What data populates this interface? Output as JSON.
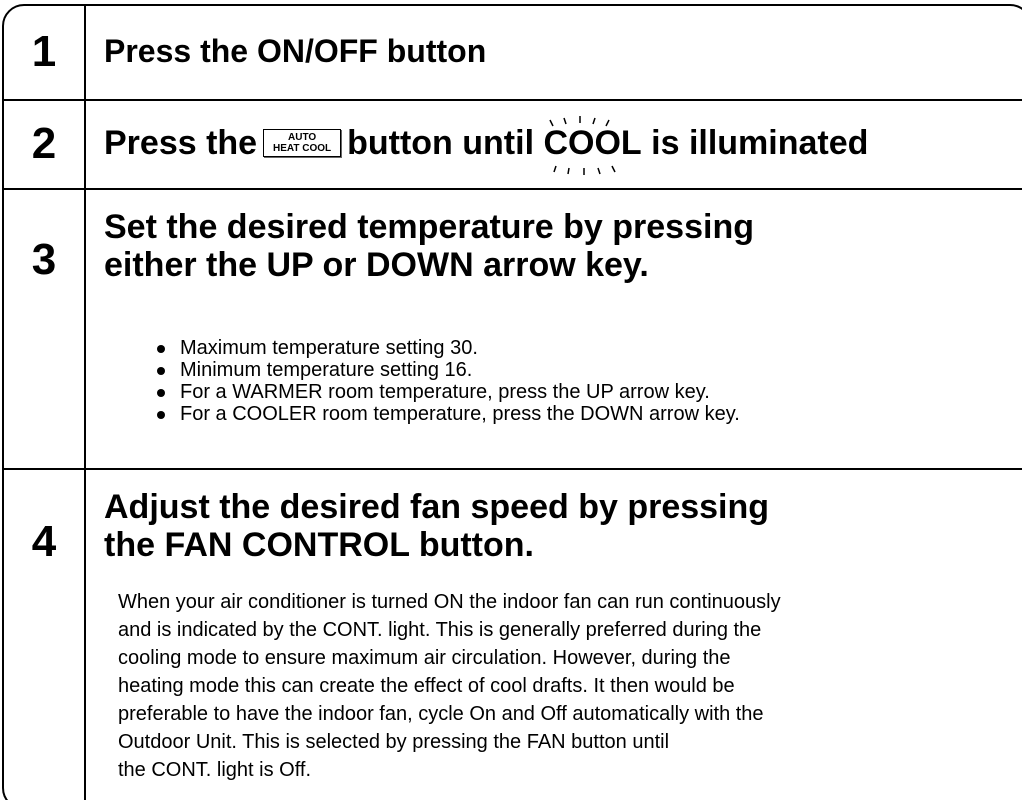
{
  "steps": [
    {
      "number": "1",
      "heading": "Press the ON/OFF button"
    },
    {
      "number": "2",
      "heading_before": "Press the",
      "mode_button_top": "AUTO",
      "mode_button_bottom": "HEAT COOL",
      "heading_middle": "button until",
      "illuminated_word": "COOL",
      "heading_after": "is illuminated"
    },
    {
      "number": "3",
      "heading_lines": [
        "Set the desired temperature by pressing",
        "either the UP or DOWN arrow key."
      ],
      "bullets": [
        "Maximum temperature setting 30.",
        "Minimum temperature setting 16.",
        "For a WARMER room temperature, press the UP arrow key.",
        "For a COOLER room temperature, press the DOWN arrow key."
      ]
    },
    {
      "number": "4",
      "heading_lines": [
        "Adjust the desired fan speed by pressing",
        "the FAN CONTROL button."
      ],
      "paragraph_lines": [
        "When your air conditioner is turned ON the indoor fan can run continuously",
        "and is indicated by the CONT. light. This is generally preferred during the",
        "cooling mode to ensure maximum air circulation. However, during the",
        "heating mode this can create the effect of cool drafts. It then would be",
        "preferable to have the indoor fan, cycle On and Off automatically with the",
        "Outdoor Unit. This is selected by pressing the FAN button until",
        "the CONT. light is Off."
      ]
    }
  ]
}
